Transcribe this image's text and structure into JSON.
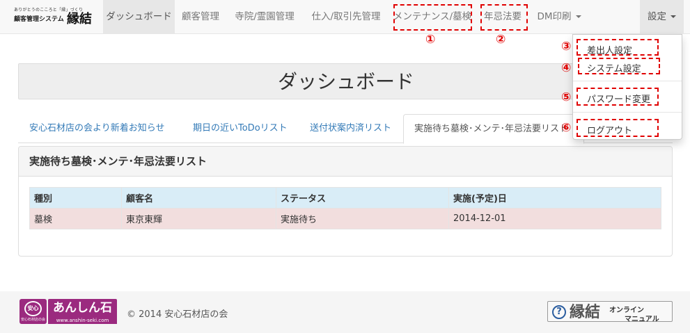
{
  "brand": {
    "tagline": "ありがとうのこころと「縁」づくり",
    "subtitle": "顧客管理システム",
    "name": "縁結"
  },
  "nav": {
    "dashboard": "ダッシュボード",
    "customers": "顧客管理",
    "temples": "寺院/霊園管理",
    "suppliers": "仕入/取引先管理",
    "maintenance": "メンテナンス/墓検",
    "memorial": "年忌法要",
    "dm_print": "DM印刷",
    "settings": "設定"
  },
  "dropdown": {
    "sender": "差出人設定",
    "system": "システム設定",
    "password": "パスワード変更",
    "logout": "ログアウト"
  },
  "annotations": {
    "n1": "①",
    "n2": "②",
    "n3": "③",
    "n4": "④",
    "n5": "⑤",
    "n6": "⑥"
  },
  "page": {
    "title": "ダッシュボード"
  },
  "tabs": {
    "news": "安心石材店の会より新着お知らせ",
    "todo": "期日の近いToDoリスト",
    "sent": "送付状案内済リスト",
    "pending": "実施待ち墓検･メンテ･年忌法要リスト"
  },
  "panel": {
    "title": "実施待ち墓検･メンテ･年忌法要リスト",
    "columns": [
      "種別",
      "顧客名",
      "ステータス",
      "実施(予定)日"
    ],
    "rows": [
      [
        "墓検",
        "東京東輝",
        "実施待ち",
        "2014-12-01"
      ]
    ]
  },
  "footer": {
    "logo_badge": "安心",
    "logo_badge_text": "安心石材店の会",
    "logo_main": "あんしん石",
    "logo_url": "www.anshin-seki.com",
    "copyright": "© 2014 安心石材店の会",
    "manual_kanji": "縁結",
    "manual_line1": "オンライン",
    "manual_line2": "マニュアル"
  },
  "colors": {
    "annotation": "#e00000",
    "link": "#337ab7",
    "header_row": "#d9edf7",
    "danger_row": "#f2dede",
    "brand_purple": "#9b2a7f"
  }
}
